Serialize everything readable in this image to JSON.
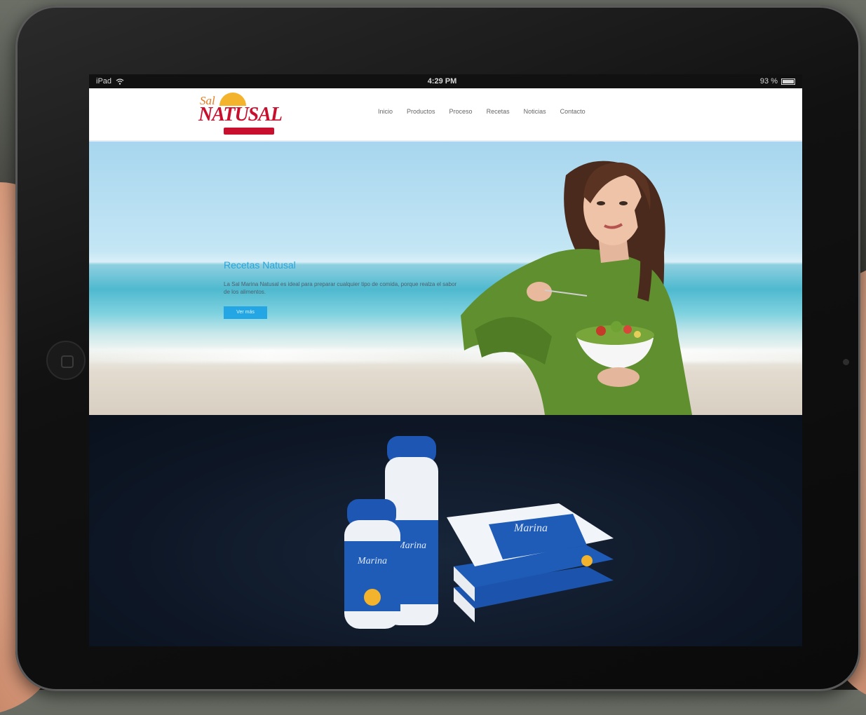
{
  "device": {
    "status_left": "iPad",
    "status_time": "4:29 PM",
    "status_battery": "93 %"
  },
  "site": {
    "logo": {
      "small": "Sal",
      "main": "NATUSAL"
    },
    "nav": [
      {
        "label": "Inicio"
      },
      {
        "label": "Productos"
      },
      {
        "label": "Proceso"
      },
      {
        "label": "Recetas"
      },
      {
        "label": "Noticias"
      },
      {
        "label": "Contacto"
      }
    ],
    "hero": {
      "title": "Recetas Natusal",
      "description": "La Sal Marina Natusal es ideal para preparar cualquier tipo de comida, porque realza el sabor de los alimentos.",
      "button": "Ver más"
    },
    "products": {
      "brand_label": "Marina"
    }
  },
  "colors": {
    "brand_red": "#c8102e",
    "brand_orange": "#f4b32c",
    "accent_blue": "#23a6e3",
    "product_blue": "#1b4fa8",
    "dark_section": "#0e1726"
  }
}
